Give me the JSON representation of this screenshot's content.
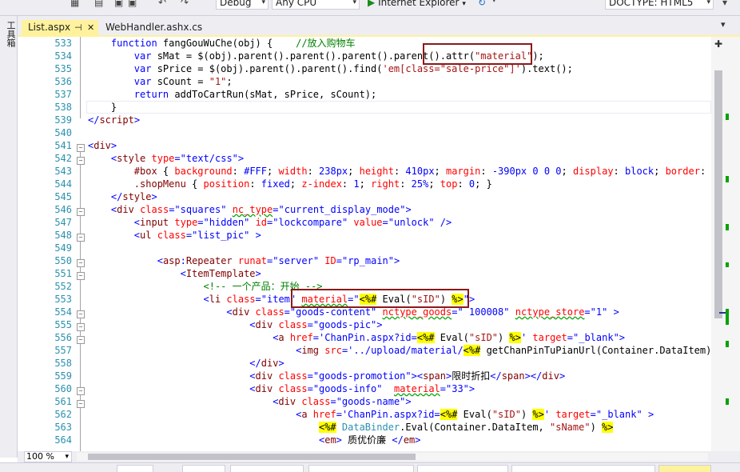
{
  "toolbar": {
    "config": "Debug",
    "platform": "Any CPU",
    "run_target": "Internet Explorer",
    "doctype": "DOCTYPE: HTML5"
  },
  "toolbox": {
    "label": "工具箱"
  },
  "tabs": [
    {
      "label": "List.aspx",
      "active": true
    },
    {
      "label": "WebHandler.ashx.cs",
      "active": false
    }
  ],
  "editor": {
    "line_numbers": [
      "533",
      "534",
      "535",
      "536",
      "537",
      "538",
      "539",
      "540",
      "541",
      "542",
      "543",
      "544",
      "545",
      "546",
      "547",
      "548",
      "549",
      "550",
      "551",
      "552",
      "553",
      "554",
      "555",
      "556",
      "557",
      "558",
      "559",
      "560",
      "561",
      "562",
      "563",
      "564"
    ]
  },
  "zoom": "100 %",
  "colors": {
    "tab_active": "#fff29d",
    "line_number": "#2b91af",
    "keyword": "#0000ff",
    "tag": "#800000",
    "attribute": "#ff0000",
    "string": "#a31515",
    "comment": "#008000",
    "highlight_box": "#8b1a1a",
    "change_marker": "#00a300"
  }
}
